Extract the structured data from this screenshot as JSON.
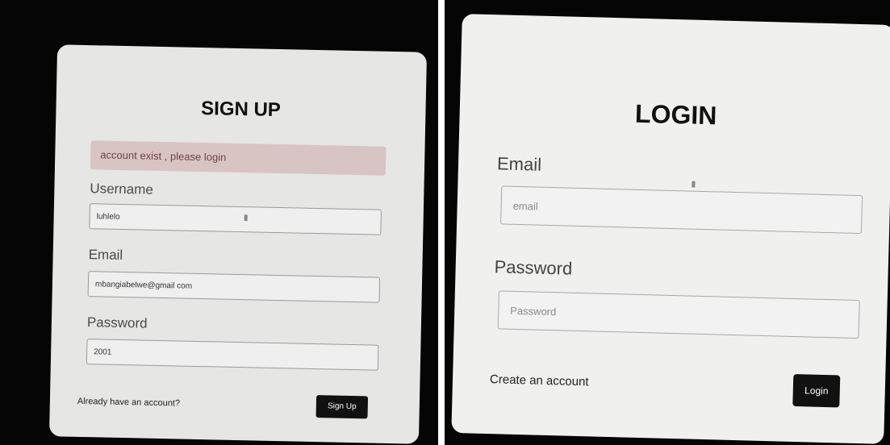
{
  "signup": {
    "title": "SIGN UP",
    "alert": "account exist , please login",
    "username_label": "Username",
    "username_value": "luhlelo",
    "email_label": "Email",
    "email_value": "mbangiabelwe@gmail com",
    "password_label": "Password",
    "password_value": "2001",
    "login_link": "Already have an account?",
    "submit_label": "Sign Up"
  },
  "login": {
    "title": "LOGIN",
    "email_label": "Email",
    "email_placeholder": "email",
    "password_label": "Password",
    "password_placeholder": "Password",
    "create_link": "Create an account",
    "submit_label": "Login"
  },
  "colors": {
    "alert_bg": "#d9c4c4",
    "button_bg": "#111111"
  }
}
